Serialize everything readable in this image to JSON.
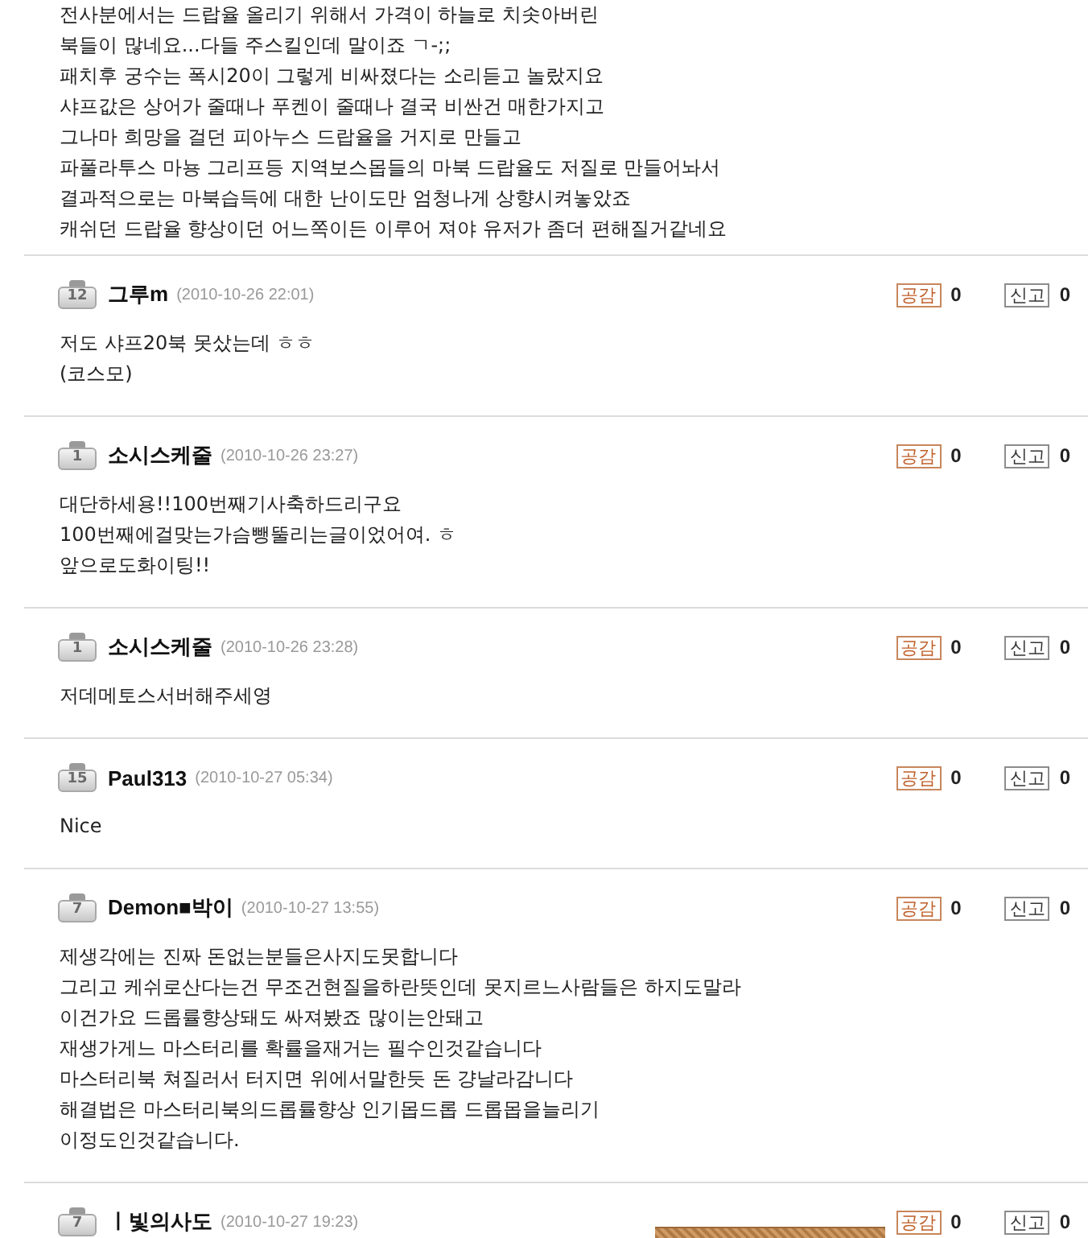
{
  "post_tail": {
    "lines": [
      "전사분에서는 드랍율 올리기 위해서 가격이 하늘로 치솟아버린",
      "북들이 많네요...다들 주스킬인데 말이죠 ㄱ-;;",
      "패치후 궁수는 폭시20이 그렇게 비싸졌다는 소리듣고 놀랐지요",
      "샤프값은 상어가 줄때나 푸켄이 줄때나 결국 비싼건 매한가지고",
      "그나마 희망을 걸던 피아누스 드랍율을 거지로 만들고",
      "파풀라투스 마뇽 그리프등 지역보스몹들의 마북 드랍율도 저질로 만들어놔서",
      "결과적으로는 마북습득에 대한 난이도만 엄청나게 상향시켜놓았죠",
      "캐쉬던 드랍율 향상이던 어느쪽이든 이루어 져야 유저가 좀더 편해질거같네요"
    ]
  },
  "comments": [
    {
      "level": "12",
      "author": "그루m",
      "date": "(2010-10-26 22:01)",
      "empathy": {
        "label": "공감",
        "count": "0"
      },
      "report": {
        "label": "신고",
        "count": "0"
      },
      "lines": [
        "저도 샤프20북 못샀는데 ㅎㅎ",
        "(코스모)"
      ]
    },
    {
      "level": "1",
      "author": "소시스케줄",
      "date": "(2010-10-26 23:27)",
      "empathy": {
        "label": "공감",
        "count": "0"
      },
      "report": {
        "label": "신고",
        "count": "0"
      },
      "lines": [
        "대단하세용!!100번째기사축하드리구요",
        "100번째에걸맞는가슴뺑뚤리는글이었어여. ㅎ",
        "앞으로도화이팅!!"
      ]
    },
    {
      "level": "1",
      "author": "소시스케줄",
      "date": "(2010-10-26 23:28)",
      "empathy": {
        "label": "공감",
        "count": "0"
      },
      "report": {
        "label": "신고",
        "count": "0"
      },
      "lines": [
        "저데메토스서버해주세영"
      ]
    },
    {
      "level": "15",
      "author": "Paul313",
      "date": "(2010-10-27 05:34)",
      "empathy": {
        "label": "공감",
        "count": "0"
      },
      "report": {
        "label": "신고",
        "count": "0"
      },
      "lines": [
        "Nice"
      ]
    },
    {
      "level": "7",
      "author": "Demon■박이",
      "date": "(2010-10-27 13:55)",
      "empathy": {
        "label": "공감",
        "count": "0"
      },
      "report": {
        "label": "신고",
        "count": "0"
      },
      "lines": [
        "제생각에는 진짜 돈없는분들은사지도못합니다",
        "그리고 케쉬로산다는건 무조건현질을하란뜻인데 못지르느사람들은 하지도말라",
        "이건가요 드롭률향상돼도 싸져봤죠 많이는안돼고",
        "재생가게느 마스터리를 확률을재거는 필수인것같습니다",
        "마스터리북 쳐질러서 터지면 위에서말한듯 돈 걍날라감니다",
        "해결법은 마스터리북의드롭률향상 인기몹드롭 드롭몹을늘리기",
        "이정도인것같습니다."
      ]
    },
    {
      "level": "7",
      "author": "ㅣ빛의사도",
      "date": "(2010-10-27 19:23)",
      "empathy": {
        "label": "공감",
        "count": "0"
      },
      "report": {
        "label": "신고",
        "count": "0"
      }
    }
  ]
}
